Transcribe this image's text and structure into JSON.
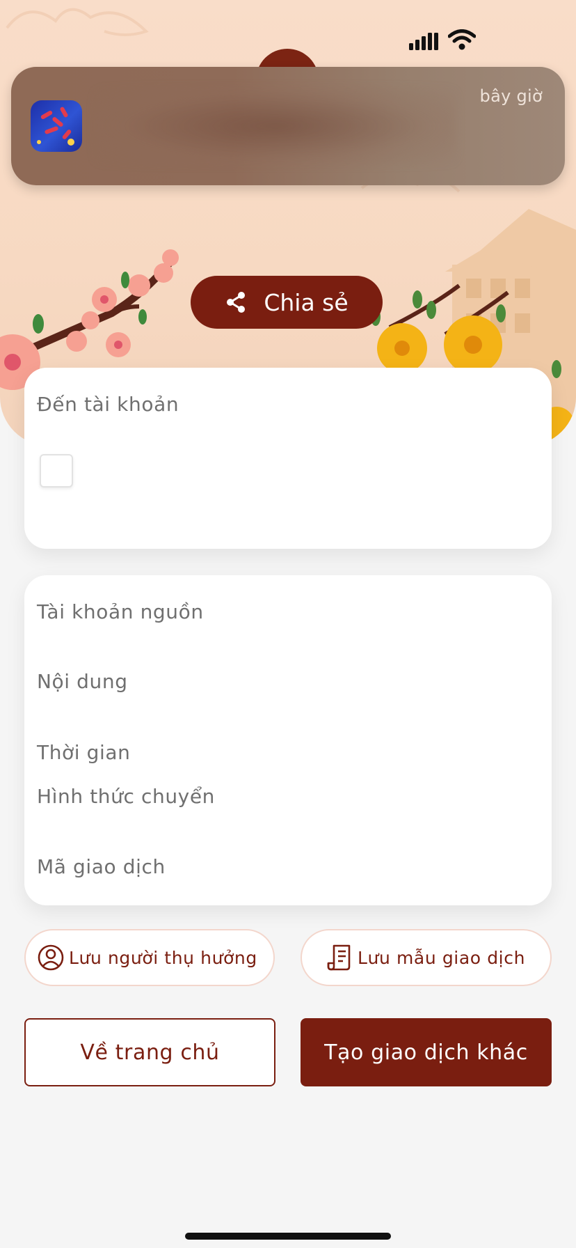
{
  "notification": {
    "time": "bây giờ"
  },
  "share": {
    "label": "Chia sẻ"
  },
  "destination_card": {
    "label": "Đến tài khoản"
  },
  "info_card": {
    "rows": [
      {
        "label": "Tài khoản nguồn"
      },
      {
        "label": "Nội dung"
      },
      {
        "label": "Thời gian"
      },
      {
        "label": "Hình thức chuyển"
      },
      {
        "label": "Mã giao dịch"
      }
    ]
  },
  "actions": {
    "save_beneficiary": "Lưu người thụ hưởng",
    "save_template": "Lưu mẫu giao dịch",
    "home": "Về trang chủ",
    "new_transaction": "Tạo giao dịch khác"
  },
  "icons": {
    "status_signal": "cellular-signal-icon",
    "status_wifi": "wifi-icon",
    "share": "share-icon",
    "person": "person-circle-icon",
    "receipt": "receipt-icon"
  },
  "colors": {
    "brand": "#7a1e10",
    "header_bg": "#f9ddc9",
    "card_bg": "#ffffff",
    "label_text": "#6f6f6f"
  }
}
